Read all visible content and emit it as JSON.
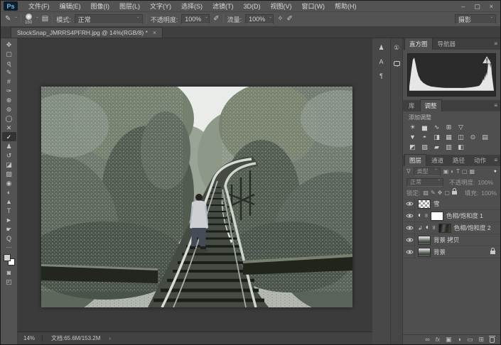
{
  "menubar": {
    "logo": "Ps",
    "items": [
      "文件(F)",
      "编辑(E)",
      "图像(I)",
      "图层(L)",
      "文字(Y)",
      "选择(S)",
      "滤镜(T)",
      "3D(D)",
      "视图(V)",
      "窗口(W)",
      "帮助(H)"
    ]
  },
  "window_controls": {
    "minimize": "–",
    "maximize": "▢",
    "close": "×"
  },
  "options_bar": {
    "tool_icon": "✎",
    "brush_size": "150",
    "panel_toggle_icon": "▤",
    "mode_label": "模式:",
    "mode_value": "正常",
    "opacity_label": "不透明度:",
    "opacity_value": "100%",
    "pressure_icon": "✐",
    "flow_label": "流量:",
    "flow_value": "100%",
    "airbrush_icon": "✧",
    "workspace": "摄影",
    "caret": "ˇ"
  },
  "document_tab": {
    "title": "StockSnap_JMRRS4PFRH.jpg @ 14%(RGB/8) *",
    "close": "×"
  },
  "toolbar": {
    "tools": [
      {
        "name": "move-tool",
        "glyph": "✥"
      },
      {
        "name": "marquee-tool",
        "glyph": "▢"
      },
      {
        "name": "lasso-tool",
        "glyph": "ɋ"
      },
      {
        "name": "quick-selection-tool",
        "glyph": "✎"
      },
      {
        "name": "crop-tool",
        "glyph": "#"
      },
      {
        "name": "eyedropper-tool",
        "glyph": "✑"
      },
      {
        "name": "spot-healing-tool",
        "glyph": "⊕"
      },
      {
        "name": "patch-tool",
        "glyph": "⊚"
      },
      {
        "name": "red-eye-tool",
        "glyph": "◯"
      },
      {
        "name": "content-aware-move-tool",
        "glyph": "✕"
      },
      {
        "name": "brush-tool",
        "glyph": "✓",
        "selected": true
      },
      {
        "name": "clone-stamp-tool",
        "glyph": "♟"
      },
      {
        "name": "history-brush-tool",
        "glyph": "↺"
      },
      {
        "name": "eraser-tool",
        "glyph": "◪"
      },
      {
        "name": "gradient-tool",
        "glyph": "▨"
      },
      {
        "name": "blur-tool",
        "glyph": "◉"
      },
      {
        "name": "dodge-tool",
        "glyph": "◐"
      },
      {
        "name": "pen-tool",
        "glyph": "▲"
      },
      {
        "name": "type-tool",
        "glyph": "T"
      },
      {
        "name": "path-selection-tool",
        "glyph": "►"
      },
      {
        "name": "hand-tool",
        "glyph": "☛"
      },
      {
        "name": "zoom-tool",
        "glyph": "Q"
      }
    ],
    "more": "⋯",
    "quick_mask": "◙",
    "screen_mode": "◰"
  },
  "collapsed_docks": {
    "clone_source": "♟",
    "character": "A",
    "paragraph": "¶",
    "info": "①"
  },
  "histogram_panel": {
    "tabs": [
      "直方图",
      "导航器"
    ],
    "menu_icon": "≡"
  },
  "adjustments_panel": {
    "tabs": [
      "库",
      "调整"
    ],
    "label": "添加调整",
    "row1": [
      "☀",
      "▅",
      "∿",
      "⊞",
      "▽"
    ],
    "row2": [
      "▼",
      "◓",
      "◨",
      "▦",
      "◫",
      "⊙",
      "▤"
    ],
    "row3": [
      "◩",
      "▧",
      "▰",
      "▥",
      "◧"
    ]
  },
  "layers_panel": {
    "tabs": [
      "图层",
      "通道",
      "路径",
      "动作"
    ],
    "menu_icon": "≡",
    "filter_funnel": "∇",
    "filter_type": "类型",
    "filter_icons": [
      "▣",
      "◐",
      "T",
      "▢",
      "▩"
    ],
    "filter_toggle": "●",
    "blend_mode": "正常",
    "opacity_label": "不透明度:",
    "opacity_value": "100%",
    "lock_label": "锁定:",
    "lock_icons": [
      "▨",
      "✎",
      "✥",
      "▢"
    ],
    "fill_label": "填充:",
    "fill_value": "100%",
    "link8": "8",
    "clip_arrow": "↲",
    "adj_circle": "◐",
    "layers": [
      {
        "name": "雪"
      },
      {
        "name": "色相/饱和度 1"
      },
      {
        "name": "色相/饱和度 2"
      },
      {
        "name": "背景 拷贝"
      },
      {
        "name": "背景"
      }
    ],
    "bottom_icons": {
      "link": "∞",
      "fx": "fx",
      "mask": "▣",
      "adjust": "◑",
      "group": "▭",
      "new_layer": "⊞"
    }
  },
  "status_bar": {
    "zoom": "14%",
    "doc_label": "文档:65.6M/153.2M",
    "chevron": "›"
  },
  "colors": {
    "logo_blue": "#6fb8e8",
    "bar_bg": "#535353",
    "canvas_bg": "#3b3b3b",
    "panel_bg": "#4f4f4f",
    "histogram_well": "#2b2b2b",
    "text": "#d6d6d6",
    "dim_text": "#9a9a9a"
  }
}
